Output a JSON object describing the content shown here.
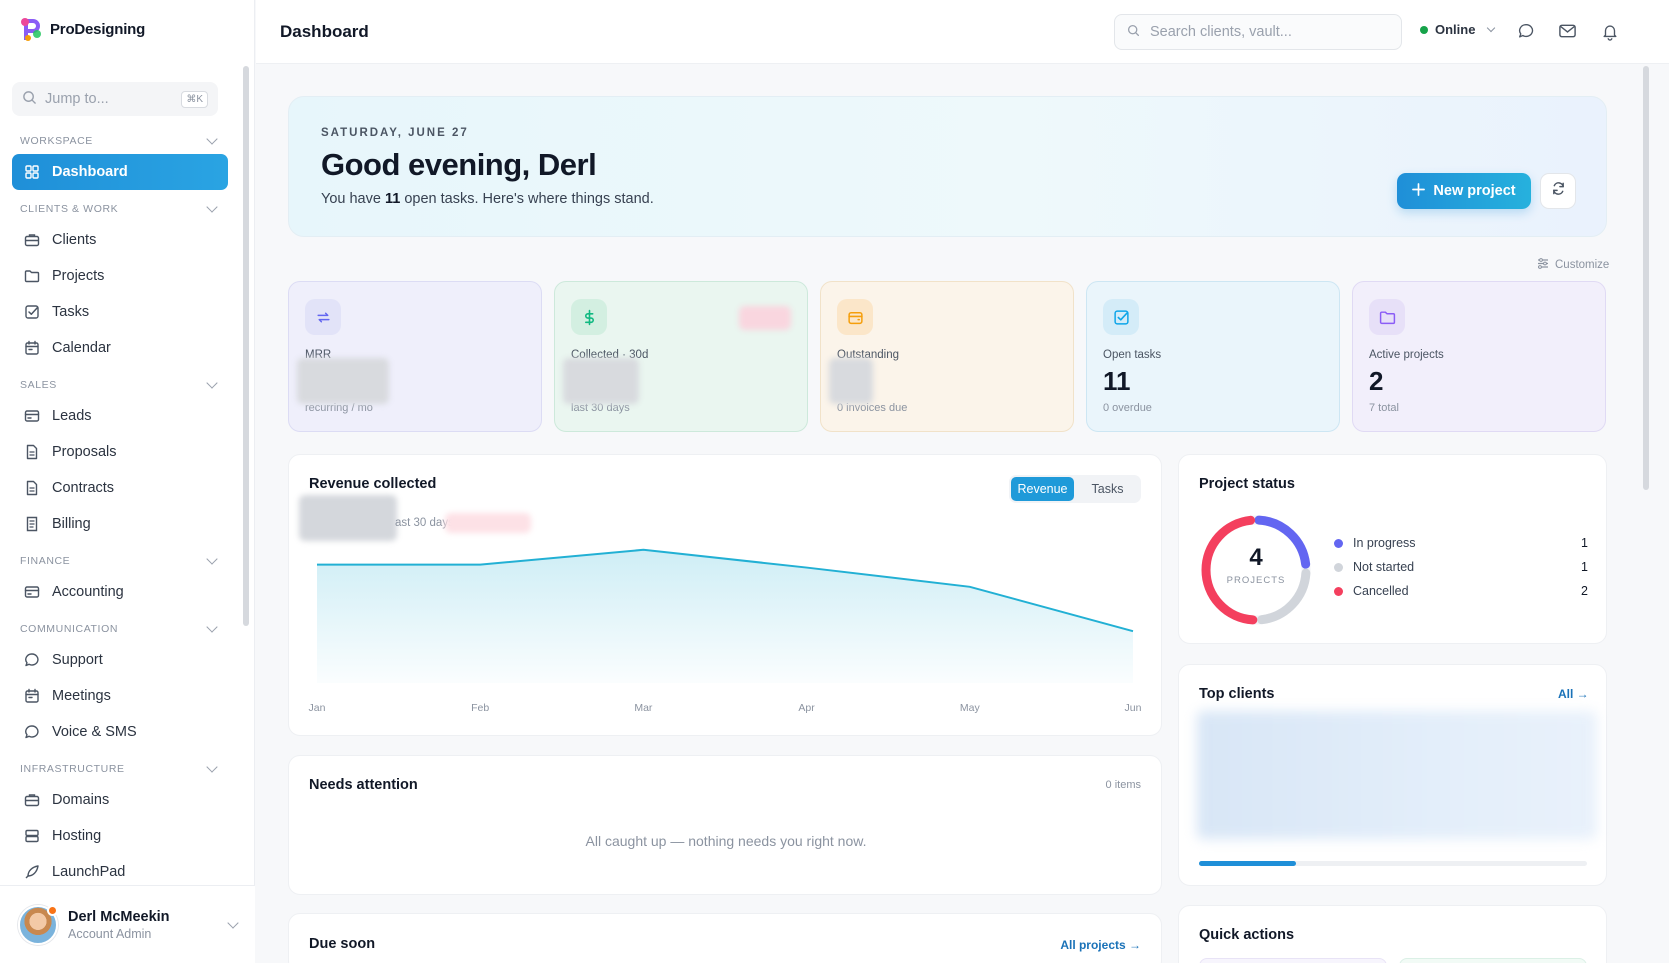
{
  "app": {
    "name": "ProDesigning"
  },
  "sidebar": {
    "jump_placeholder": "Jump to...",
    "jump_shortcut": "⌘K",
    "sections": [
      {
        "label": "WORKSPACE",
        "items": [
          {
            "label": "Dashboard",
            "icon": "grid-icon",
            "active": true
          }
        ]
      },
      {
        "label": "CLIENTS & WORK",
        "items": [
          {
            "label": "Clients",
            "icon": "briefcase-icon"
          },
          {
            "label": "Projects",
            "icon": "folder-icon"
          },
          {
            "label": "Tasks",
            "icon": "checkbox-icon"
          },
          {
            "label": "Calendar",
            "icon": "calendar-icon"
          }
        ]
      },
      {
        "label": "SALES",
        "items": [
          {
            "label": "Leads",
            "icon": "card-icon"
          },
          {
            "label": "Proposals",
            "icon": "document-icon"
          },
          {
            "label": "Contracts",
            "icon": "document-icon"
          },
          {
            "label": "Billing",
            "icon": "receipt-icon"
          }
        ]
      },
      {
        "label": "FINANCE",
        "items": [
          {
            "label": "Accounting",
            "icon": "card-icon"
          }
        ]
      },
      {
        "label": "COMMUNICATION",
        "items": [
          {
            "label": "Support",
            "icon": "chat-icon"
          },
          {
            "label": "Meetings",
            "icon": "calendar-icon"
          },
          {
            "label": "Voice & SMS",
            "icon": "chat-icon"
          }
        ]
      },
      {
        "label": "INFRASTRUCTURE",
        "items": [
          {
            "label": "Domains",
            "icon": "briefcase-icon"
          },
          {
            "label": "Hosting",
            "icon": "server-icon"
          },
          {
            "label": "LaunchPad",
            "icon": "rocket-icon"
          }
        ]
      }
    ],
    "user": {
      "name": "Derl McMeekin",
      "role": "Account Admin"
    }
  },
  "topbar": {
    "title": "Dashboard",
    "search_placeholder": "Search clients, vault...",
    "status": "Online",
    "status_color": "#16a34a"
  },
  "hero": {
    "date": "SATURDAY, JUNE 27",
    "greeting": "Good evening, Derl",
    "sub_prefix": "You have ",
    "open_tasks": "11",
    "sub_suffix": " open tasks. Here's where things stand.",
    "new_project": "New project"
  },
  "customize": "Customize",
  "kpis": [
    {
      "label": "MRR",
      "value": "",
      "sub": "recurring / mo",
      "icon": "repeat-icon",
      "accent": "#6366f1"
    },
    {
      "label": "Collected · 30d",
      "value": "",
      "sub": "last 30 days",
      "icon": "dollar-icon",
      "accent": "#10b981"
    },
    {
      "label": "Outstanding",
      "value": "",
      "sub": "0 invoices due",
      "icon": "wallet-icon",
      "accent": "#f59e0b"
    },
    {
      "label": "Open tasks",
      "value": "11",
      "sub": "0 overdue",
      "icon": "checkbox-icon",
      "accent": "#0ea5e9"
    },
    {
      "label": "Active projects",
      "value": "2",
      "sub": "7 total",
      "icon": "folder-icon",
      "accent": "#8b5cf6"
    }
  ],
  "revenue": {
    "title": "Revenue collected",
    "subtitle": "ast 30 days",
    "tabs": [
      "Revenue",
      "Tasks"
    ],
    "active_tab": "Revenue"
  },
  "chart_data": {
    "type": "area",
    "categories": [
      "Jan",
      "Feb",
      "Mar",
      "Apr",
      "May",
      "Jun"
    ],
    "values": [
      0.8,
      0.8,
      0.9,
      0.78,
      0.65,
      0.35
    ],
    "title": "Revenue collected",
    "xlabel": "",
    "ylabel": "",
    "grid": false,
    "color": "#22b0d4"
  },
  "project_status": {
    "title": "Project status",
    "total": "4",
    "total_label": "PROJECTS",
    "items": [
      {
        "label": "In progress",
        "count": "1",
        "color": "#6366f1",
        "value": 1
      },
      {
        "label": "Not started",
        "count": "1",
        "color": "#d1d5db",
        "value": 1
      },
      {
        "label": "Cancelled",
        "count": "2",
        "color": "#f43f5e",
        "value": 2
      }
    ]
  },
  "needs_attention": {
    "title": "Needs attention",
    "count": "0 items",
    "empty": "All caught up — nothing needs you right now."
  },
  "top_clients": {
    "title": "Top clients",
    "link": "All →",
    "progress": 0.25
  },
  "due_soon": {
    "title": "Due soon",
    "link": "All projects →"
  },
  "quick_actions": {
    "title": "Quick actions"
  }
}
